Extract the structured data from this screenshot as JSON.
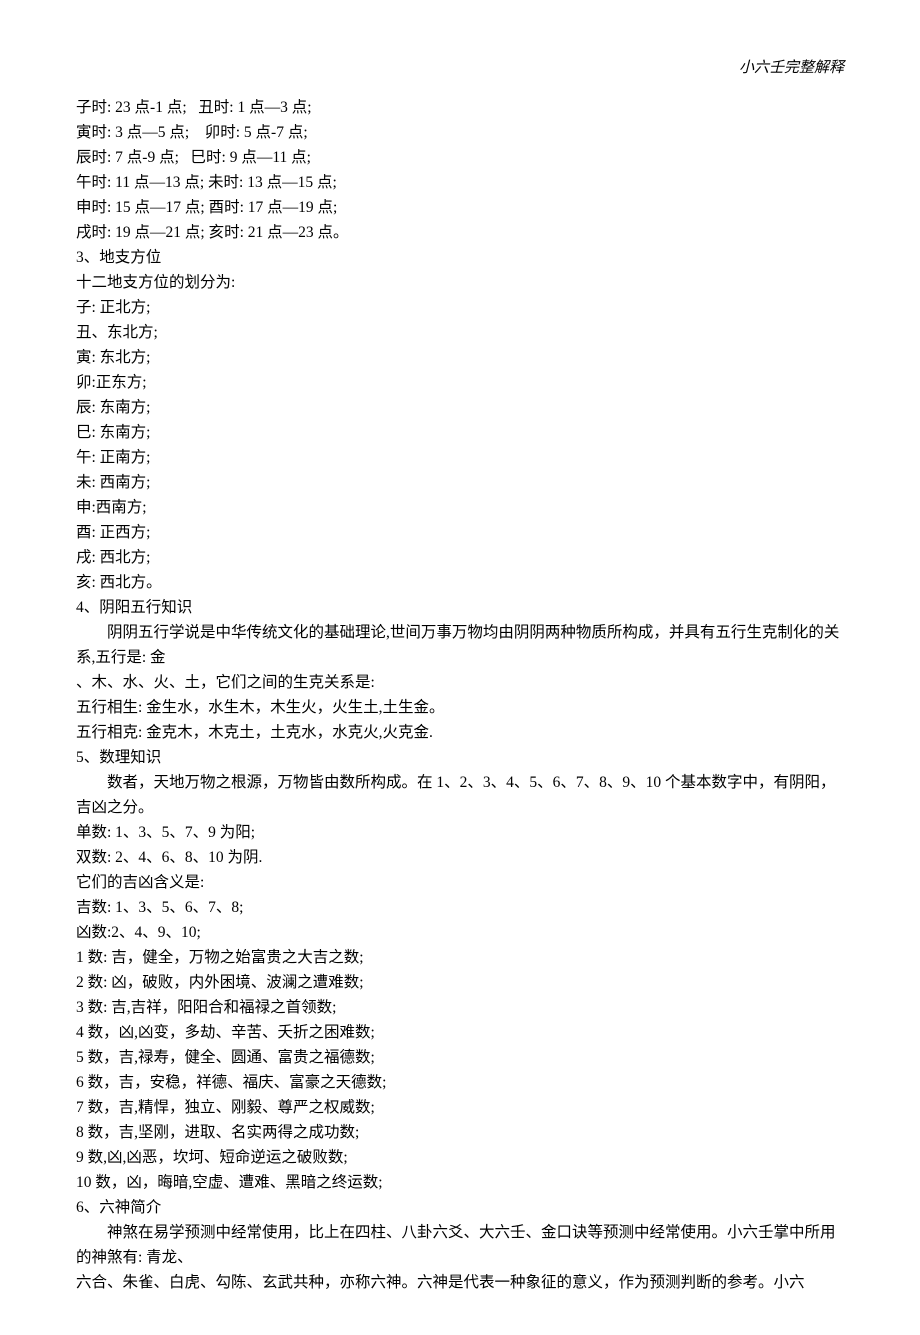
{
  "header": "小六壬完整解释",
  "lines": [
    "子时: 23 点-1 点;   丑时: 1 点—3 点;",
    "寅时: 3 点—5 点;    卯时: 5 点-7 点;",
    "辰时: 7 点-9 点;   巳时: 9 点—11 点;",
    "午时: 11 点—13 点; 未时: 13 点—15 点;",
    "申时: 15 点—17 点; 酉时: 17 点—19 点;",
    "戌时: 19 点—21 点; 亥时: 21 点—23 点。",
    "3、地支方位",
    "十二地支方位的划分为:",
    "子: 正北方;",
    "丑、东北方;",
    "寅: 东北方;",
    "卯:正东方;",
    "辰: 东南方;",
    "巳: 东南方;",
    "午: 正南方;",
    "未: 西南方;",
    "申:西南方;",
    "酉: 正西方;",
    "戌: 西北方;",
    "亥: 西北方。",
    "4、阴阳五行知识"
  ],
  "para1": "阴阴五行学说是中华传统文化的基础理论,世间万事万物均由阴阴两种物质所构成，并具有五行生克制化的关系,五行是: 金",
  "lines2": [
    "、木、水、火、土，它们之间的生克关系是:",
    "五行相生: 金生水，水生木，木生火，火生土,土生金。",
    "五行相克: 金克木，木克土，土克水，水克火,火克金.",
    "5、数理知识"
  ],
  "para2": "数者，天地万物之根源，万物皆由数所构成。在 1、2、3、4、5、6、7、8、9、10 个基本数字中，有阴阳，吉凶之分。",
  "lines3": [
    "单数: 1、3、5、7、9 为阳;",
    "双数: 2、4、6、8、10 为阴.",
    "它们的吉凶含义是:",
    "吉数: 1、3、5、6、7、8;",
    "凶数:2、4、9、10;",
    "1 数: 吉，健全，万物之始富贵之大吉之数;",
    "2 数: 凶，破败，内外困境、波澜之遭难数;",
    "3 数: 吉,吉祥，阳阳合和福禄之首领数;",
    "4 数，凶,凶变，多劫、辛苦、夭折之困难数;",
    "5 数，吉,禄寿，健全、圆通、富贵之福德数;",
    "6 数，吉，安稳，祥德、福庆、富豪之天德数;",
    "7 数，吉,精悍，独立、刚毅、尊严之权威数;",
    "8 数，吉,坚刚，进取、名实两得之成功数;",
    "9 数,凶,凶恶，坎坷、短命逆运之破败数;",
    "10 数，凶，晦暗,空虚、遭难、黑暗之终运数;",
    "6、六神简介"
  ],
  "para3": "神煞在易学预测中经常使用，比上在四柱、八卦六爻、大六壬、金口诀等预测中经常使用。小六壬掌中所用的神煞有: 青龙、",
  "lines4": [
    "六合、朱雀、白虎、勾陈、玄武共种，亦称六神。六神是代表一种象征的意义，作为预测判断的参考。小六"
  ]
}
